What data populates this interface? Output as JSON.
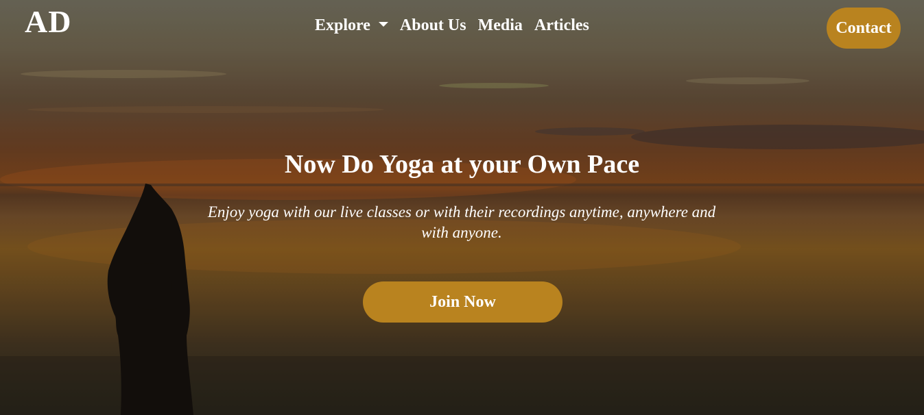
{
  "brand": {
    "logo_text": "AD"
  },
  "nav": {
    "items": [
      {
        "label": "Explore",
        "has_dropdown": true
      },
      {
        "label": "About Us"
      },
      {
        "label": "Media"
      },
      {
        "label": "Articles"
      }
    ],
    "contact_label": "Contact"
  },
  "hero": {
    "title": "Now Do Yoga at your Own Pace",
    "subtitle": "Enjoy yoga with our live classes or with their recordings anytime, anywhere and with anyone.",
    "cta_label": "Join Now"
  },
  "colors": {
    "accent": "#b9831f",
    "text": "#ffffff"
  },
  "icons": {
    "dropdown": "caret-down-icon"
  }
}
